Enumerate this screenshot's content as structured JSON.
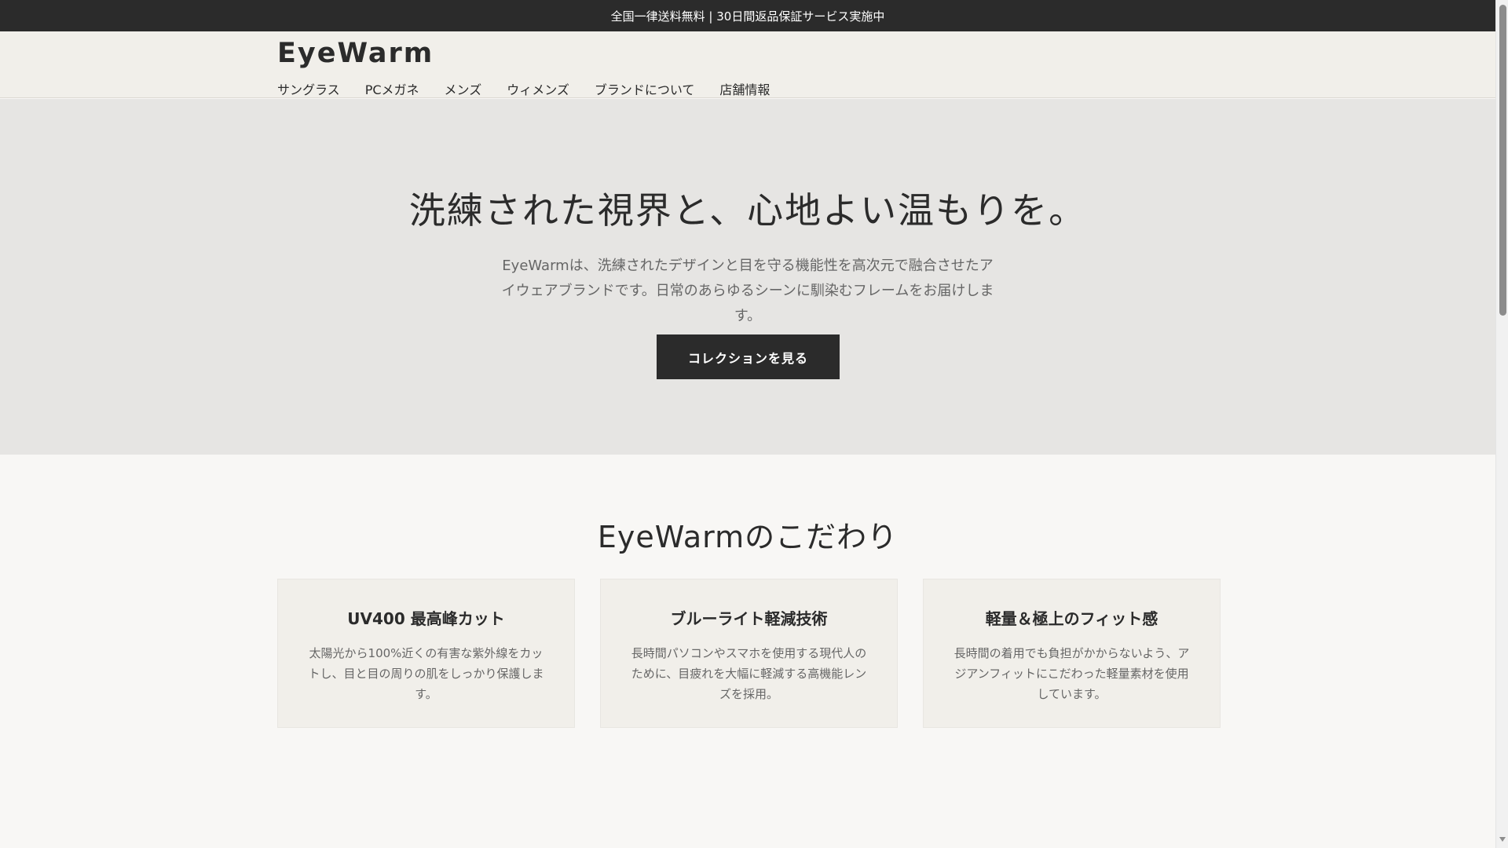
{
  "announcement": {
    "text": "全国一律送料無料 | 30日間返品保証サービス実施中"
  },
  "header": {
    "logo": "EyeWarm",
    "nav": [
      {
        "label": "サングラス"
      },
      {
        "label": "PCメガネ"
      },
      {
        "label": "メンズ"
      },
      {
        "label": "ウィメンズ"
      },
      {
        "label": "ブランドについて"
      },
      {
        "label": "店舗情報"
      }
    ]
  },
  "hero": {
    "title": "洗練された視界と、心地よい温もりを。",
    "description": "EyeWarmは、洗練されたデザインと目を守る機能性を高次元で融合させたアイウェアブランドです。日常のあらゆるシーンに馴染むフレームをお届けします。",
    "cta_label": "コレクションを見る"
  },
  "features": {
    "title": "EyeWarmのこだわり",
    "cards": [
      {
        "title": "UV400 最高峰カット",
        "text": "太陽光から100%近くの有害な紫外線をカットし、目と目の周りの肌をしっかり保護します。"
      },
      {
        "title": "ブルーライト軽減技術",
        "text": "長時間パソコンやスマホを使用する現代人のために、目疲れを大幅に軽減する高機能レンズを採用。"
      },
      {
        "title": "軽量＆極上のフィット感",
        "text": "長時間の着用でも負担がかからないよう、アジアンフィットにこだわった軽量素材を使用しています。"
      }
    ]
  },
  "colors": {
    "dark": "#2b2b2b",
    "header_bg": "#f1efea",
    "hero_bg": "#e6e5e3",
    "page_bg": "#f8f7f5",
    "muted_text": "#666666"
  }
}
